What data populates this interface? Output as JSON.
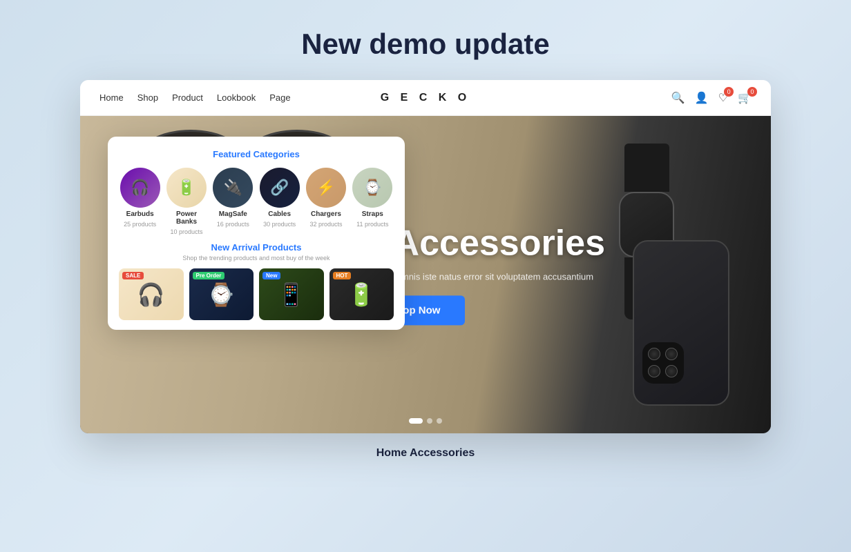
{
  "page": {
    "title": "New demo update",
    "bottom_label": "Home Accessories"
  },
  "navbar": {
    "brand": "G E C K O",
    "links": [
      {
        "label": "Home",
        "active": false
      },
      {
        "label": "Shop",
        "active": false
      },
      {
        "label": "Product",
        "active": false
      },
      {
        "label": "Lookbook",
        "active": false
      },
      {
        "label": "Page",
        "active": false
      }
    ],
    "cart_count": "0",
    "wishlist_count": "0"
  },
  "hero": {
    "headline": "e Accessories",
    "subtext": "is unde omnis iste natus error sit voluptatem accusantium",
    "cta": "Shop Now",
    "slide_count": 3,
    "active_slide": 0
  },
  "popup": {
    "featured_title": "Featured Categories",
    "categories": [
      {
        "name": "Earbuds",
        "count": "25 products",
        "icon": "🎧"
      },
      {
        "name": "Power Banks",
        "count": "10 products",
        "icon": "🔋"
      },
      {
        "name": "MagSafe",
        "count": "16 products",
        "icon": "🔌"
      },
      {
        "name": "Cables",
        "count": "30 products",
        "icon": "🔗"
      },
      {
        "name": "Chargers",
        "count": "32 products",
        "icon": "⚡"
      },
      {
        "name": "Straps",
        "count": "11 products",
        "icon": "⌚"
      }
    ],
    "new_arrivals_title": "New Arrival Products",
    "new_arrivals_sub": "Shop the trending products and most buy of the week",
    "products": [
      {
        "badge": "SALE",
        "badge_type": "sale",
        "icon": "🎧"
      },
      {
        "badge": "Pre Order",
        "badge_type": "preorder",
        "icon": "⌚"
      },
      {
        "badge": "New",
        "badge_type": "new",
        "icon": "📱"
      },
      {
        "badge": "HOT",
        "badge_type": "hot",
        "icon": "🔋"
      }
    ]
  }
}
